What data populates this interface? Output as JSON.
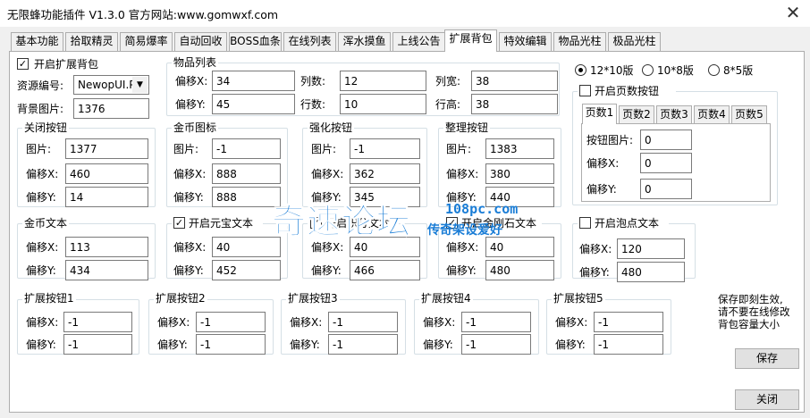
{
  "window": {
    "title": "无限蜂功能插件 V1.3.0 官方网站:www.gomwxf.com",
    "close_glyph": "✕"
  },
  "tabs": [
    {
      "label": "基本功能"
    },
    {
      "label": "拾取精灵"
    },
    {
      "label": "简易爆率"
    },
    {
      "label": "自动回收"
    },
    {
      "label": "BOSS血条"
    },
    {
      "label": "在线列表"
    },
    {
      "label": "浑水摸鱼"
    },
    {
      "label": "上线公告"
    },
    {
      "label": "扩展背包"
    },
    {
      "label": "特效编辑"
    },
    {
      "label": "物品光柱"
    },
    {
      "label": "极品光柱"
    }
  ],
  "active_tab": "扩展背包",
  "bag": {
    "enable_label": "开启扩展背包",
    "enable_checked": true,
    "resource_label": "资源编号:",
    "resource_value": "NewopUI.Pak",
    "bg_label": "背景图片:",
    "bg_value": "1376"
  },
  "item_list": {
    "title": "物品列表",
    "offset_x_label": "偏移X:",
    "offset_x": "34",
    "offset_y_label": "偏移Y:",
    "offset_y": "45",
    "cols_label": "列数:",
    "cols": "12",
    "rows_label": "行数:",
    "rows": "10",
    "col_width_label": "列宽:",
    "col_width": "38",
    "row_height_label": "行高:",
    "row_height": "38"
  },
  "layout_options": {
    "options": [
      "12*10版",
      "10*8版",
      "8*5版"
    ],
    "selected": "12*10版"
  },
  "close_button_grp": {
    "title": "关闭按钮",
    "img_label": "图片:",
    "img": "1377",
    "x_label": "偏移X:",
    "x": "460",
    "y_label": "偏移Y:",
    "y": "14"
  },
  "gold_icon_grp": {
    "title": "金币图标",
    "img_label": "图片:",
    "img": "-1",
    "x_label": "偏移X:",
    "x": "888",
    "y_label": "偏移Y:",
    "y": "888"
  },
  "enhance_btn_grp": {
    "title": "强化按钮",
    "img_label": "图片:",
    "img": "-1",
    "x_label": "偏移X:",
    "x": "362",
    "y_label": "偏移Y:",
    "y": "345"
  },
  "sort_btn_grp": {
    "title": "整理按钮",
    "img_label": "图片:",
    "img": "1383",
    "x_label": "偏移X:",
    "x": "380",
    "y_label": "偏移Y:",
    "y": "440"
  },
  "page_btn": {
    "enable_label": "开启页数按钮",
    "enable_checked": false,
    "tabs": [
      "页数1",
      "页数2",
      "页数3",
      "页数4",
      "页数5"
    ],
    "active_tab": "页数1",
    "img_label": "按钮图片:",
    "img": "0",
    "x_label": "偏移X:",
    "x": "0",
    "y_label": "偏移Y:",
    "y": "0"
  },
  "gold_text_grp": {
    "title": "金币文本",
    "x_label": "偏移X:",
    "x": "113",
    "y_label": "偏移Y:",
    "y": "434"
  },
  "yuanbao_text_grp": {
    "title": "开启元宝文本",
    "checked": true,
    "x_label": "偏移X:",
    "x": "40",
    "y_label": "偏移Y:",
    "y": "452"
  },
  "third_text_grp": {
    "title": "开启积分文本",
    "checked": true,
    "x_label": "偏移X:",
    "x": "40",
    "y_label": "偏移Y:",
    "y": "466"
  },
  "fourth_text_grp": {
    "title": "开启金刚石文本",
    "checked": true,
    "x_label": "偏移X:",
    "x": "40",
    "y_label": "偏移Y:",
    "y": "480"
  },
  "bubble_text_grp": {
    "title": "开启泡点文本",
    "checked": false,
    "x_label": "偏移X:",
    "x": "120",
    "y_label": "偏移Y:",
    "y": "480"
  },
  "ext_buttons": [
    {
      "title": "扩展按钮1",
      "x_label": "偏移X:",
      "x": "-1",
      "y_label": "偏移Y:",
      "y": "-1"
    },
    {
      "title": "扩展按钮2",
      "x_label": "偏移X:",
      "x": "-1",
      "y_label": "偏移Y:",
      "y": "-1"
    },
    {
      "title": "扩展按钮3",
      "x_label": "偏移X:",
      "x": "-1",
      "y_label": "偏移Y:",
      "y": "-1"
    },
    {
      "title": "扩展按钮4",
      "x_label": "偏移X:",
      "x": "-1",
      "y_label": "偏移Y:",
      "y": "-1"
    },
    {
      "title": "扩展按钮5",
      "x_label": "偏移X:",
      "x": "-1",
      "y_label": "偏移Y:",
      "y": "-1"
    }
  ],
  "notice": {
    "line1": "保存即刻生效,",
    "line2": "请不要在线修改",
    "line3": "背包容量大小"
  },
  "save_label": "保存",
  "close_label": "关闭",
  "watermark": {
    "main": "奇速论坛",
    "site": "108pc.com",
    "sub": "传奇架设爱好"
  },
  "colors": {
    "watermark": "#1a7dd6"
  }
}
